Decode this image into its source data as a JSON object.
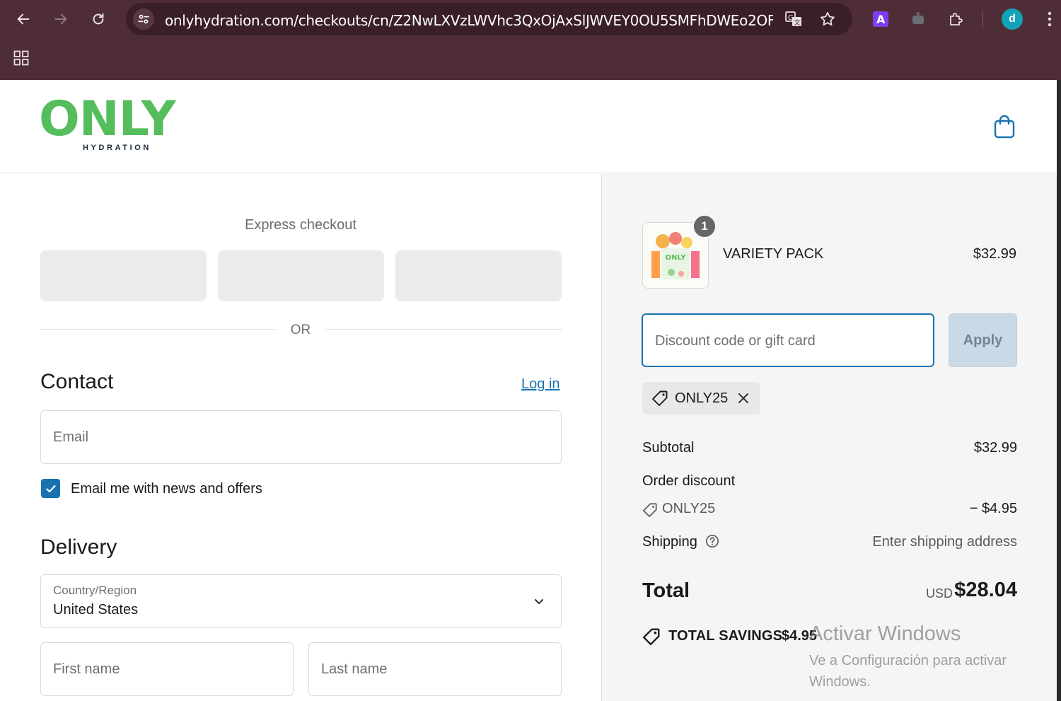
{
  "browser": {
    "url": "onlyhydration.com/checkouts/cn/Z2NwLXVzLWVhc3QxOjAxSlJWVEY0OU5SMFhDWEo2OFA...",
    "profile_initial": "d",
    "extension_letter": "A"
  },
  "header": {
    "logo_main": "ONLY",
    "logo_sub": "HYDRATION"
  },
  "express": {
    "title": "Express checkout",
    "or_text": "OR"
  },
  "contact": {
    "heading": "Contact",
    "login_label": "Log in",
    "email_placeholder": "Email",
    "newsletter_label": "Email me with news and offers",
    "newsletter_checked": true
  },
  "delivery": {
    "heading": "Delivery",
    "country_label": "Country/Region",
    "country_value": "United States",
    "first_name_placeholder": "First name",
    "last_name_placeholder": "Last name"
  },
  "summary": {
    "item": {
      "name": "VARIETY PACK",
      "price": "$32.99",
      "quantity": "1",
      "thumb_text": "ONLY"
    },
    "discount_placeholder": "Discount code or gift card",
    "apply_label": "Apply",
    "applied_code": "ONLY25",
    "subtotal_label": "Subtotal",
    "subtotal_value": "$32.99",
    "order_discount_label": "Order discount",
    "order_discount_code": "ONLY25",
    "order_discount_value": "− $4.95",
    "shipping_label": "Shipping",
    "shipping_value": "Enter shipping address",
    "total_label": "Total",
    "total_currency": "USD",
    "total_value": "$28.04",
    "savings_label": "TOTAL SAVINGS",
    "savings_value": "$4.95"
  },
  "watermark": {
    "title": "Activar Windows",
    "subtitle": "Ve a Configuración para activar Windows."
  },
  "colors": {
    "brand_green": "#56bd5d",
    "link_blue": "#1773b0",
    "chrome_bg": "#4f2d36"
  }
}
